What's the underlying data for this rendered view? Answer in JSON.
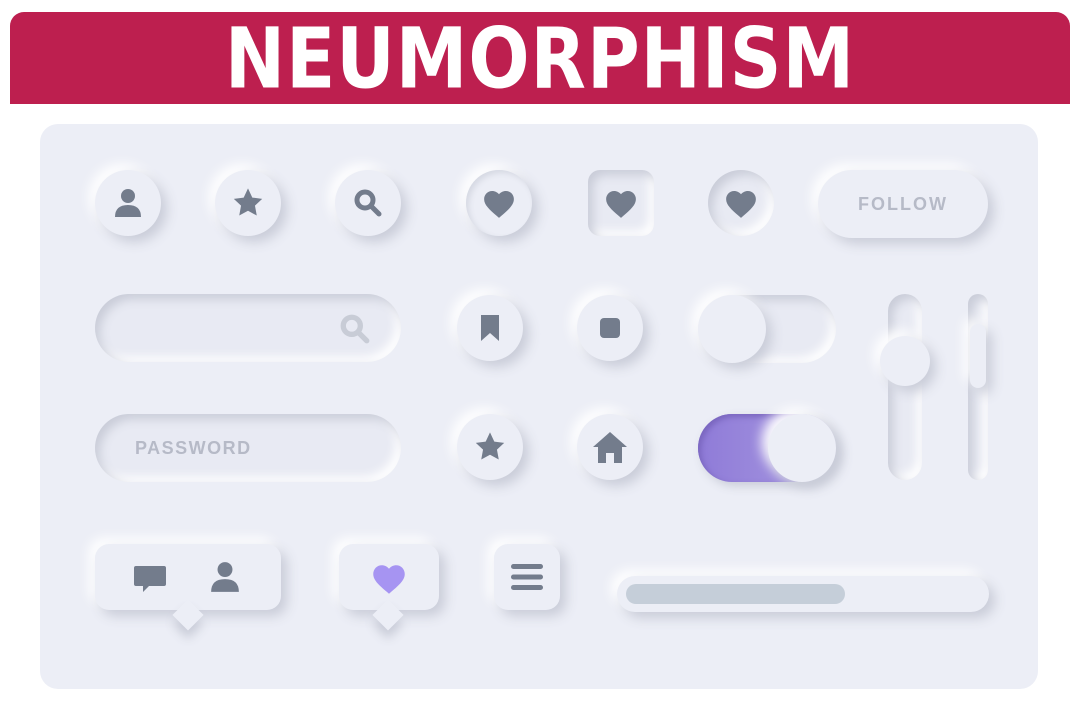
{
  "banner": {
    "title": "NEUMORPHISM",
    "color": "#bd1f4f"
  },
  "buttons": {
    "follow_label": "FOLLOW",
    "icon_buttons": [
      "user",
      "star",
      "search",
      "heart",
      "heart-square",
      "heart",
      "bookmark",
      "stop",
      "star",
      "home",
      "menu"
    ]
  },
  "inputs": {
    "search": {
      "value": "",
      "icon": "search-icon"
    },
    "password": {
      "placeholder": "PASSWORD"
    }
  },
  "toggles": {
    "top": {
      "on": false
    },
    "bottom": {
      "on": true,
      "accent": "#9b85e0"
    }
  },
  "sliders": {
    "vertical_1": {
      "level": 0.25
    },
    "vertical_2": {
      "level": 0.5
    }
  },
  "bubbles": {
    "chat": {
      "icons": [
        "chat-icon",
        "user-icon"
      ]
    },
    "like": {
      "icon": "heart-icon",
      "color": "#a694f2"
    }
  },
  "progress": {
    "value": 0.62
  },
  "colors": {
    "background": "#eceef6",
    "icon": "#737c8c"
  }
}
